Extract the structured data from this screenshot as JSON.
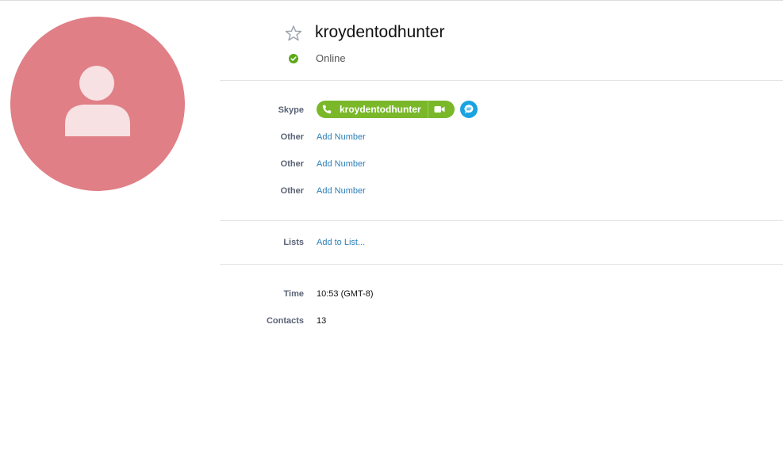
{
  "profile": {
    "display_name": "kroydentodhunter",
    "status": "Online",
    "status_color": "#5ca817",
    "avatar_color": "#e07f86"
  },
  "contact_info": {
    "skype_label": "Skype",
    "skype_name": "kroydentodhunter",
    "other_rows": [
      {
        "label": "Other",
        "action": "Add Number"
      },
      {
        "label": "Other",
        "action": "Add Number"
      },
      {
        "label": "Other",
        "action": "Add Number"
      }
    ]
  },
  "lists": {
    "label": "Lists",
    "action": "Add to List..."
  },
  "details": {
    "time_label": "Time",
    "time_value": "10:53 (GMT-8)",
    "contacts_label": "Contacts",
    "contacts_value": "13"
  },
  "icons": {
    "favorite": "star-outline-icon",
    "status": "check-circle-icon",
    "call": "phone-icon",
    "video": "video-camera-icon",
    "chat": "chat-bubble-icon"
  },
  "colors": {
    "skype_green": "#7ab82a",
    "chat_blue": "#1aa3e0",
    "link_blue": "#2b7fb8",
    "label_gray": "#5a6275"
  }
}
